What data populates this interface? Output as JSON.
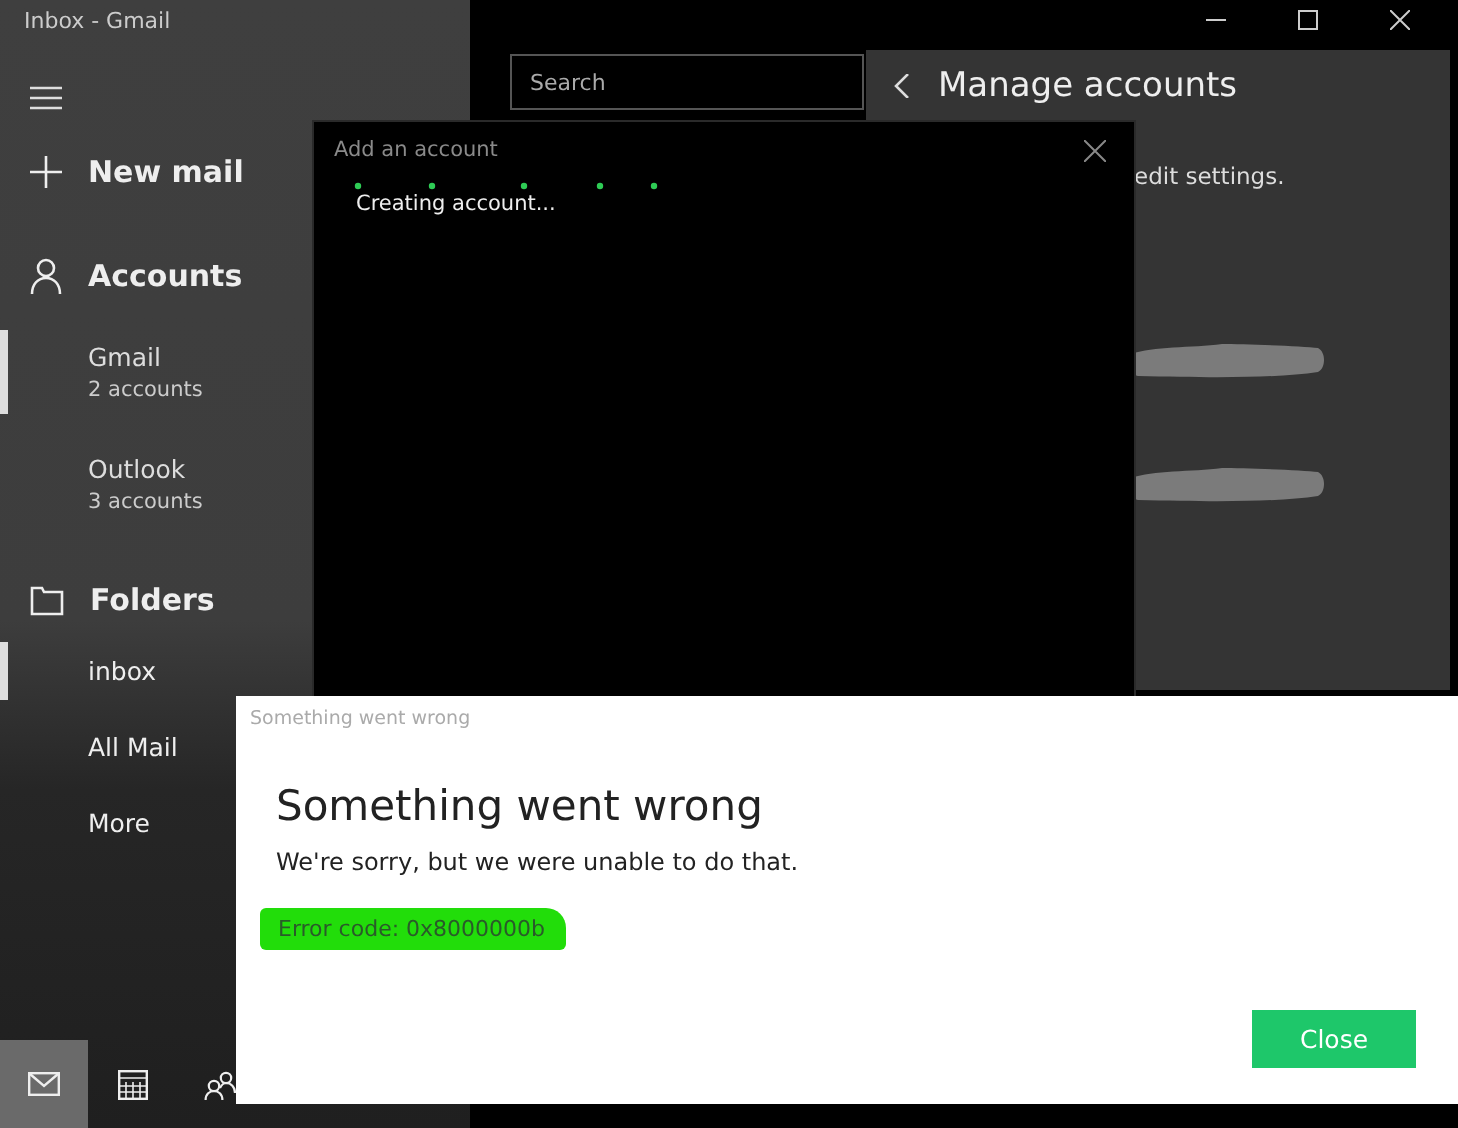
{
  "window": {
    "title": "Inbox - Gmail"
  },
  "sidebar": {
    "new_mail": "New mail",
    "accounts_heading": "Accounts",
    "accounts": [
      {
        "name": "Gmail",
        "count": "2 accounts",
        "selected": true
      },
      {
        "name": "Outlook",
        "count": "3 accounts",
        "selected": false
      }
    ],
    "folders_heading": "Folders",
    "folders": [
      {
        "label": "inbox",
        "selected": true
      },
      {
        "label": "All Mail",
        "selected": false
      },
      {
        "label": "More",
        "selected": false
      }
    ],
    "bottom_nav": [
      {
        "kind": "mail",
        "selected": true
      },
      {
        "kind": "calendar",
        "selected": false
      },
      {
        "kind": "people",
        "selected": false
      }
    ]
  },
  "search": {
    "placeholder": "Search"
  },
  "manage_accounts": {
    "title": "Manage accounts",
    "hint": "edit settings."
  },
  "add_account_dialog": {
    "title": "Add an account",
    "status": "Creating account..."
  },
  "error_dialog": {
    "caption": "Something went wrong",
    "heading": "Something went wrong",
    "message": "We're sorry, but we were unable to do that.",
    "error_code": "Error code: 0x8000000b",
    "highlighted": true,
    "button": "Close"
  }
}
